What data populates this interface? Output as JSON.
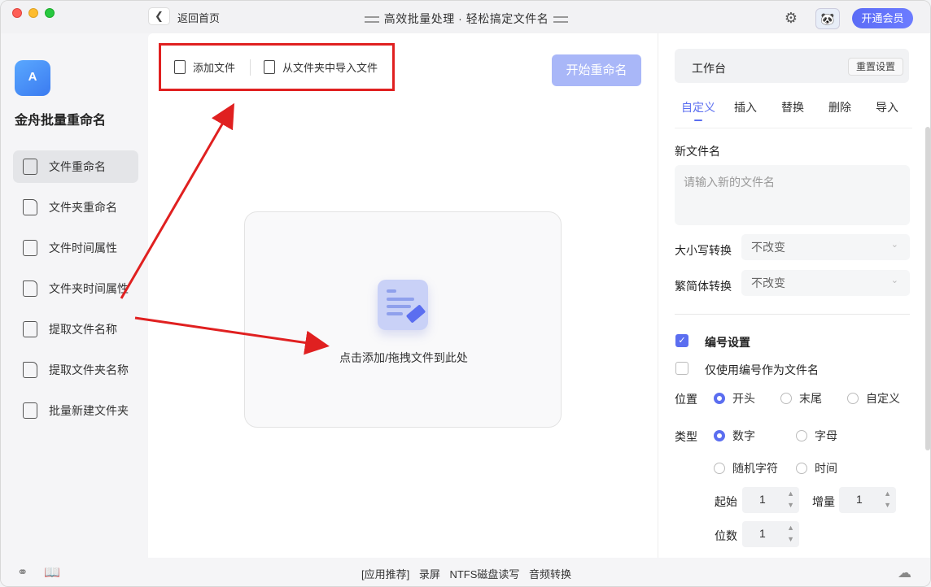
{
  "titlebar": {
    "back_label": "返回首页",
    "title": "高效批量处理 · 轻松搞定文件名",
    "vip_button": "开通会员"
  },
  "sidebar": {
    "logo_text": "A",
    "app_name": "金舟批量重命名",
    "items": [
      {
        "label": "文件重命名",
        "active": true
      },
      {
        "label": "文件夹重命名",
        "active": false
      },
      {
        "label": "文件时间属性",
        "active": false
      },
      {
        "label": "文件夹时间属性",
        "active": false
      },
      {
        "label": "提取文件名称",
        "active": false
      },
      {
        "label": "提取文件夹名称",
        "active": false
      },
      {
        "label": "批量新建文件夹",
        "active": false
      }
    ]
  },
  "toolbar": {
    "add_file": "添加文件",
    "import_folder": "从文件夹中导入文件",
    "start_rename": "开始重命名"
  },
  "dropzone": {
    "text": "点击添加/拖拽文件到此处"
  },
  "panel": {
    "workbench_title": "工作台",
    "reset_button": "重置设置",
    "tabs": [
      "自定义",
      "插入",
      "替换",
      "删除",
      "导入"
    ],
    "active_tab": "自定义",
    "new_name_label": "新文件名",
    "new_name_placeholder": "请输入新的文件名",
    "case_label": "大小写转换",
    "case_value": "不改变",
    "trad_label": "繁简体转换",
    "trad_value": "不改变",
    "numbering_label": "编号设置",
    "numbering_checked": true,
    "only_number_label": "仅使用编号作为文件名",
    "only_number_checked": false,
    "position_label": "位置",
    "position_options": [
      "开头",
      "末尾",
      "自定义"
    ],
    "position_selected": "开头",
    "type_label": "类型",
    "type_options": [
      "数字",
      "字母",
      "随机字符",
      "时间"
    ],
    "type_selected": "数字",
    "start_label": "起始",
    "start_value": "1",
    "increment_label": "增量",
    "increment_value": "1",
    "digits_label": "位数",
    "digits_value": "1"
  },
  "bottom": {
    "items": [
      "[应用推荐]",
      "录屏",
      "NTFS磁盘读写",
      "音频转换"
    ]
  },
  "colors": {
    "accent": "#5b6ef0",
    "annotation_red": "#e02020"
  }
}
